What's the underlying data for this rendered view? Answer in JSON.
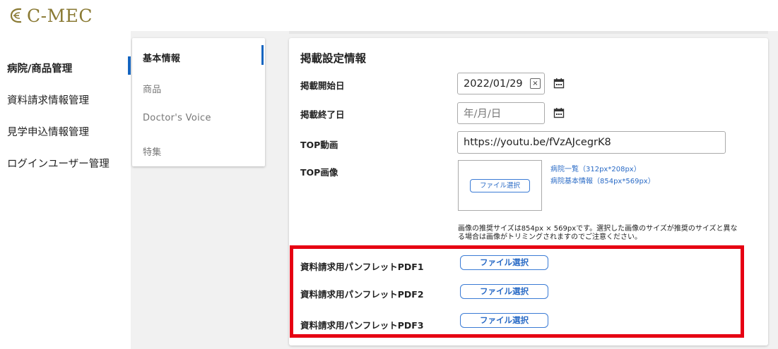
{
  "header": {
    "logo_text": "C-MEC"
  },
  "sidebar": {
    "items": [
      {
        "label": "病院/商品管理",
        "active": true
      },
      {
        "label": "資料請求情報管理",
        "active": false
      },
      {
        "label": "見学申込情報管理",
        "active": false
      },
      {
        "label": "ログインユーザー管理",
        "active": false
      }
    ]
  },
  "subnav": {
    "items": [
      {
        "label": "基本情報",
        "active": true
      },
      {
        "label": "商品",
        "active": false
      },
      {
        "label": "Doctor's Voice",
        "active": false
      },
      {
        "label": "特集",
        "active": false
      }
    ]
  },
  "form": {
    "title": "掲載設定情報",
    "start_date": {
      "label": "掲載開始日",
      "value": "2022/01/29",
      "clear": "×"
    },
    "end_date": {
      "label": "掲載終了日",
      "placeholder": "年/月/日"
    },
    "top_video": {
      "label": "TOP動画",
      "value": "https://youtu.be/fVzAJcegrK8"
    },
    "top_image": {
      "label": "TOP画像",
      "button": "ファイル選択",
      "links": [
        "病院一覧（312px*208px）",
        "病院基本情報（854px*569px）"
      ],
      "note": "画像の推奨サイズは854px × 569pxです。選択した画像のサイズが推奨のサイズと異なる場合は画像がトリミングされますのでご注意ください。"
    },
    "pdfs": [
      {
        "label": "資料請求用パンフレットPDF1",
        "button": "ファイル選択"
      },
      {
        "label": "資料請求用パンフレットPDF2",
        "button": "ファイル選択"
      },
      {
        "label": "資料請求用パンフレットPDF3",
        "button": "ファイル選択"
      }
    ]
  },
  "colors": {
    "accent": "#1565c0",
    "highlight": "#e60012",
    "logo": "#8a7a34",
    "link": "#2a6bc6"
  }
}
